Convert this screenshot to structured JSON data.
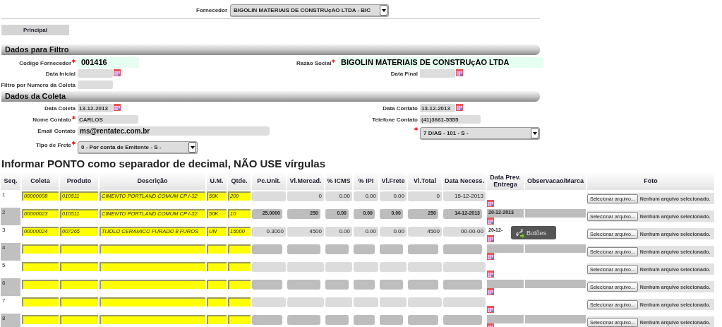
{
  "supplier_bar": {
    "label": "Fornecedor",
    "value": "BIGOLIN MATERIAIS DE CONSTRUçAO LTDA - BIC"
  },
  "tabs": [
    {
      "label": "Principal",
      "selected": true
    }
  ],
  "sections": [
    {
      "title": "Dados para Filtro",
      "rows": [
        {
          "left": {
            "label": "Codigo Fornecedor",
            "required": true,
            "kind": "highlight",
            "value": "001416"
          },
          "right": {
            "label": "Razao Social",
            "required": true,
            "kind": "highlight",
            "value": "BIGOLIN MATERIAIS DE CONSTRUçAO LTDA"
          }
        },
        {
          "left": {
            "label": "Data Inicial",
            "required": false,
            "kind": "date"
          },
          "right": {
            "label": "Data Final",
            "required": false,
            "kind": "date"
          }
        },
        {
          "left": {
            "label": "Filtro por Numero da Coleta",
            "required": false,
            "kind": "text"
          }
        }
      ]
    },
    {
      "title": "Dados da Coleta",
      "rows": [
        {
          "left": {
            "label": "Data Coleta",
            "required": false,
            "kind": "date",
            "value": "13-12-2013"
          },
          "right": {
            "label": "Data Contato",
            "required": false,
            "kind": "date",
            "value": "13-12-2013"
          }
        },
        {
          "left": {
            "label": "Nome Contato",
            "required": true,
            "kind": "text",
            "value": "CARLOS"
          },
          "right": {
            "label": "Telefone Contato",
            "required": false,
            "kind": "text",
            "value": "(41)3661-5555"
          }
        },
        {
          "left": {
            "label": "Email Contato",
            "required": false,
            "kind": "wide",
            "value": "ms@rentatec.com.br"
          },
          "right": {
            "required": true,
            "kind": "select",
            "value": "7 DIAS - 101 - S -"
          }
        },
        {
          "left": {
            "label": "Tipo de Frete",
            "required": true,
            "kind": "select",
            "value": "0 - Por conta de Emitente - S -"
          }
        }
      ]
    }
  ],
  "notice": "Informar PONTO como separador de decimal, NÃO USE vírgulas",
  "table": {
    "columns": [
      "Seq.",
      "Coleta",
      "Produto",
      "Descrição",
      "U.M.",
      "Qtde.",
      "Pc.Unit.",
      "Vl.Mercad.",
      "% ICMS",
      "% IPI",
      "Vl.Frete",
      "Vl.Total",
      "Data Necess.",
      "Data Prev. Entrega",
      "Observacao/Marca",
      "Foto"
    ],
    "rows": [
      {
        "seq": "1",
        "shaded": false,
        "coleta": "00000008",
        "produto": "010511",
        "descricao": "CIMENTO PORTLAND COMUM CP I-32",
        "um": "50K",
        "qtde": "200",
        "vl_mercad": "0",
        "icms": "0.00",
        "ipi": "0.00",
        "vl_frete": "0.00",
        "vl_total": "0",
        "data_necess": "15-12-2013",
        "button": "Selecionar arquivo...",
        "file_status": "Nenhum arquivo selecionado."
      },
      {
        "seq": "2",
        "shaded": true,
        "coleta": "00000023",
        "produto": "010511",
        "descricao": "CIMENTO PORTLAND COMUM CP I-32",
        "um": "50K",
        "qtde": "10",
        "pc_unit": "25.0000",
        "vl_mercad": "250",
        "icms": "0.00",
        "ipi": "0.00",
        "vl_frete": "0.00",
        "vl_total": "250",
        "data_necess": "14-12-2013",
        "data_prev": "20-12-2013",
        "button": "Selecionar arquivo...",
        "file_status": "Nenhum arquivo selecionado."
      },
      {
        "seq": "3",
        "shaded": false,
        "coleta": "00000024",
        "produto": "007265",
        "descricao": "TIJOLO CERAMICO FURADO 8 FUROS",
        "um": "UN",
        "qtde": "15000",
        "pc_unit": "0.3000",
        "vl_mercad": "4500",
        "icms": "0.00",
        "ipi": "0.00",
        "vl_frete": "0.00",
        "vl_total": "4500",
        "data_necess": "00-00-00",
        "data_prev": "20-12-",
        "button": "Selecionar arquivo...",
        "file_status": "Nenhum arquivo selecionado."
      },
      {
        "seq": "4",
        "shaded": true,
        "button": "Selecionar arquivo...",
        "file_status": "Nenhum arquivo selecionado."
      },
      {
        "seq": "5",
        "shaded": false,
        "button": "Selecionar arquivo...",
        "file_status": "Nenhum arquivo selecionado."
      },
      {
        "seq": "6",
        "shaded": true,
        "button": "Selecionar arquivo...",
        "file_status": "Nenhum arquivo selecionado."
      },
      {
        "seq": "7",
        "shaded": false,
        "button": "Selecionar arquivo...",
        "file_status": "Nenhum arquivo selecionado."
      },
      {
        "seq": "8",
        "shaded": true,
        "button": "Selecionar arquivo...",
        "file_status": "Nenhum arquivo selecionado."
      }
    ]
  },
  "tooltip": {
    "label": "Botões"
  }
}
